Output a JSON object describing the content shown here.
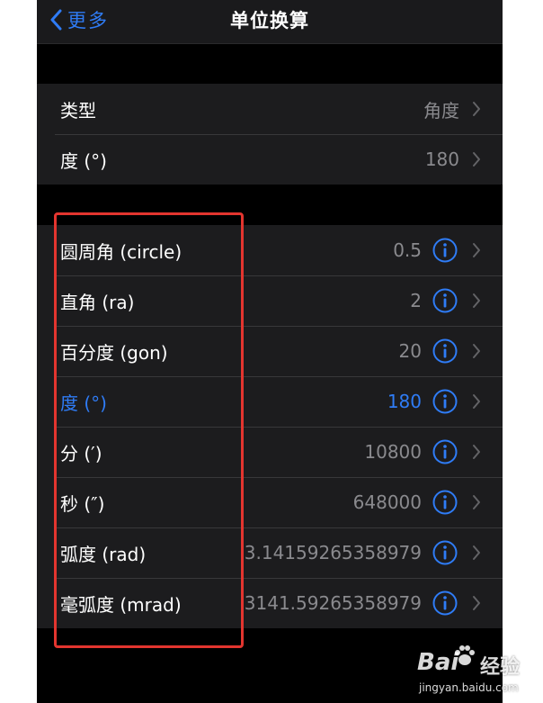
{
  "nav": {
    "back_label": "更多",
    "title": "单位换算"
  },
  "settings": [
    {
      "label": "类型",
      "value": "角度"
    },
    {
      "label": "度 (°)",
      "value": "180"
    }
  ],
  "units": [
    {
      "label": "圆周角 (circle)",
      "value": "0.5"
    },
    {
      "label": "直角 (ra)",
      "value": "2"
    },
    {
      "label": "百分度 (gon)",
      "value": "20"
    },
    {
      "label": "度 (°)",
      "value": "180",
      "selected": true
    },
    {
      "label": "分 (′)",
      "value": "10800"
    },
    {
      "label": "秒 (″)",
      "value": "648000"
    },
    {
      "label": "弧度 (rad)",
      "value": "3.14159265358979"
    },
    {
      "label": "毫弧度 (mrad)",
      "value": "3141.59265358979"
    }
  ],
  "watermark": {
    "brand": "Bai",
    "brand_suffix": "经验",
    "url": "jingyan.baidu.com"
  },
  "colors": {
    "accent": "#2f7cf6",
    "highlight": "#e3352f",
    "background": "#000000",
    "cell": "#1c1c1e"
  },
  "icons": {
    "back": "chevron-left-icon",
    "info": "info-circle-icon",
    "disclosure": "chevron-right-icon"
  }
}
